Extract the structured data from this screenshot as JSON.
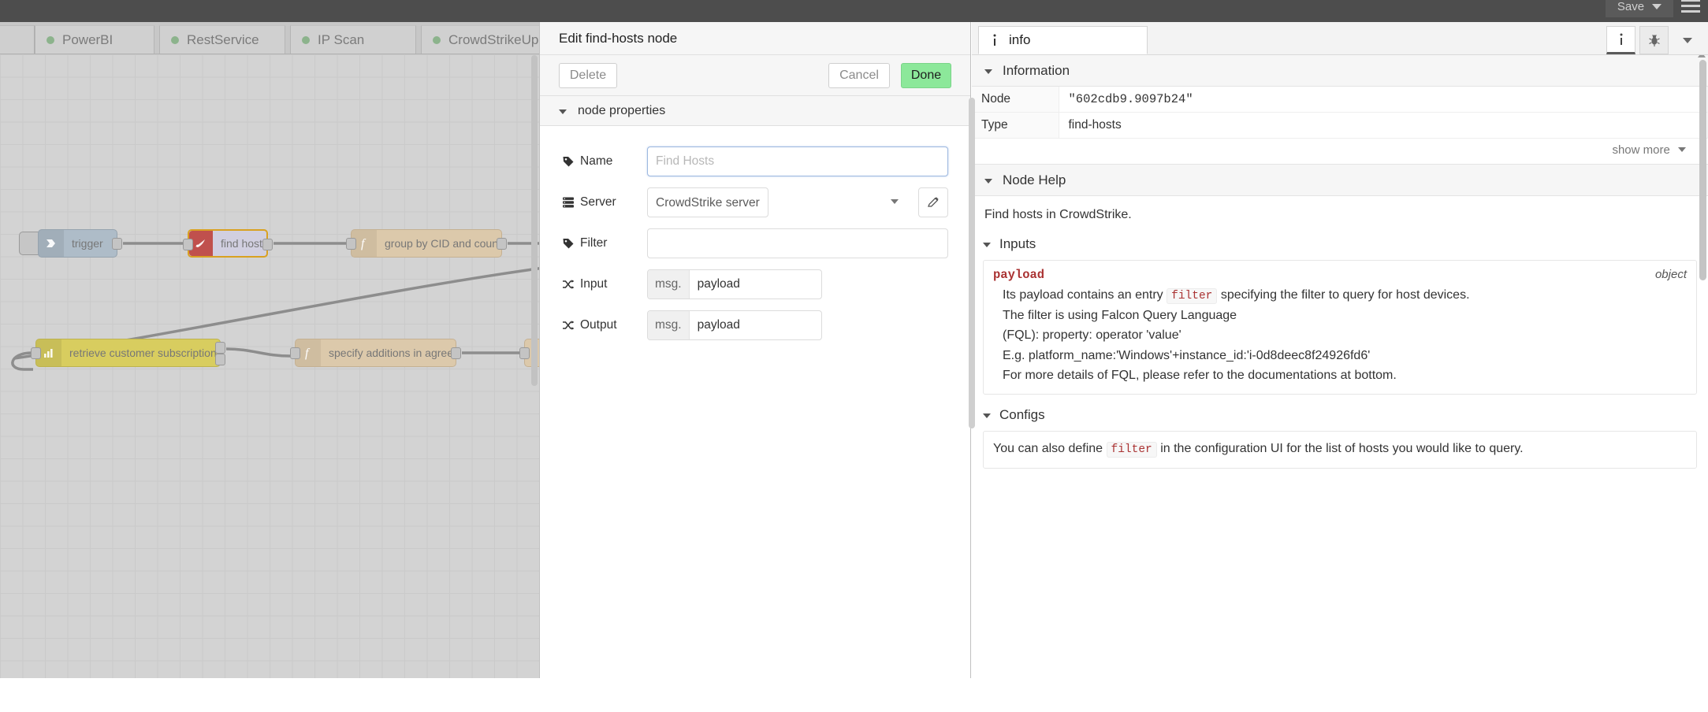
{
  "header": {
    "save_label": "Save",
    "menu_icon": "hamburger-menu-icon",
    "caret_icon": "chevron-down-icon"
  },
  "tabs": [
    {
      "label": "PowerBI",
      "status_icon": "status-dot-green"
    },
    {
      "label": "RestService",
      "status_icon": "status-dot-green"
    },
    {
      "label": "IP Scan",
      "status_icon": "status-dot-green"
    },
    {
      "label": "CrowdStrikeUpdate",
      "status_icon": "status-dot-green"
    }
  ],
  "canvas": {
    "nodes": [
      {
        "label": "trigger",
        "icon": "arrow-into-box-icon"
      },
      {
        "label": "find hosts",
        "icon": "crowdstrike-falcon-icon",
        "selected": true
      },
      {
        "label": "group by CID and count hosts",
        "icon": "function-f-icon"
      },
      {
        "label": "retrieve customer subscription details",
        "icon": "bar-chart-icon"
      },
      {
        "label": "specify additions in agreement",
        "icon": "function-f-icon"
      }
    ]
  },
  "dialog": {
    "title": "Edit find-hosts node",
    "delete_label": "Delete",
    "cancel_label": "Cancel",
    "done_label": "Done",
    "section_label": "node properties",
    "fields": {
      "name": {
        "label": "Name",
        "icon": "tag-icon",
        "value": "",
        "placeholder": "Find Hosts"
      },
      "server": {
        "label": "Server",
        "icon": "server-icon",
        "selected": "CrowdStrike server",
        "options": [
          "CrowdStrike server"
        ],
        "edit_icon": "pencil-icon"
      },
      "filter": {
        "label": "Filter",
        "icon": "tag-icon",
        "value": "",
        "placeholder": ""
      },
      "input": {
        "label": "Input",
        "icon": "shuffle-icon",
        "prefix": "msg.",
        "value": "payload"
      },
      "output": {
        "label": "Output",
        "icon": "shuffle-icon",
        "prefix": "msg.",
        "value": "payload"
      }
    }
  },
  "sidebar": {
    "tab_label": "info",
    "tab_icon": "info-icon",
    "tools": [
      {
        "name": "info-button",
        "icon": "info-icon",
        "active": true
      },
      {
        "name": "debug-button",
        "icon": "bug-icon",
        "active": false
      },
      {
        "name": "more-button",
        "icon": "chevron-down-icon",
        "active": false
      }
    ],
    "information": {
      "header": "Information",
      "rows": [
        {
          "key": "Node",
          "value": "\"602cdb9.9097b24\"",
          "mono": true
        },
        {
          "key": "Type",
          "value": "find-hosts",
          "mono": false
        }
      ],
      "show_more_label": "show more"
    },
    "node_help": {
      "header": "Node Help",
      "description": "Find hosts in CrowdStrike.",
      "inputs": {
        "header": "Inputs",
        "property": "payload",
        "type": "object",
        "desc_line1_pre": "Its payload contains an entry",
        "desc_line1_code": "filter",
        "desc_line2": "specifying the filter to query for host devices.",
        "desc_line3": "The filter is using Falcon Query Language",
        "desc_line4": "(FQL): property: operator 'value'",
        "desc_line5": "E.g. platform_name:'Windows'+instance_id:'i-0d8deec8f24926fd6'",
        "desc_line6": "For more details of FQL, please refer to the documentations at bottom."
      },
      "configs": {
        "header": "Configs",
        "line_pre": "You can also define",
        "line_code": "filter",
        "line_post": "in the configuration UI for the list of hosts you would like to query."
      }
    }
  },
  "colors": {
    "header_bg": "#4d4d4d",
    "done_green": "#8ce89a",
    "node_selected_border": "#d9a122",
    "status_dot": "#8cb38c",
    "code_red": "#a33333"
  }
}
